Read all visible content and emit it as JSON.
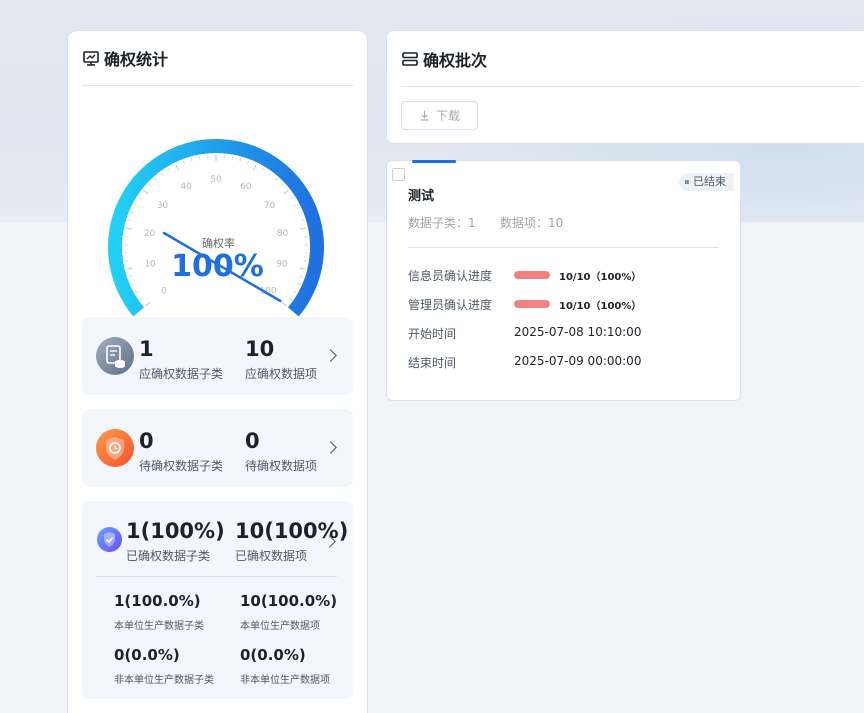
{
  "stats_panel": {
    "title": "确权统计",
    "gauge": {
      "label": "确权率",
      "value_text": "100%",
      "value": 100,
      "ticks": [
        "0",
        "10",
        "20",
        "30",
        "40",
        "50",
        "60",
        "70",
        "80",
        "90",
        "100"
      ]
    },
    "should_confirm": {
      "subclass_count": "1",
      "subclass_label": "应确权数据子类",
      "item_count": "10",
      "item_label": "应确权数据项"
    },
    "pending": {
      "subclass_count": "0",
      "subclass_label": "待确权数据子类",
      "item_count": "0",
      "item_label": "待确权数据项"
    },
    "confirmed": {
      "subclass_count": "1(100%)",
      "subclass_label": "已确权数据子类",
      "item_count": "10(100%)",
      "item_label": "已确权数据项",
      "own_subclass": "1(100.0%)",
      "own_subclass_label": "本单位生产数据子类",
      "own_item": "10(100.0%)",
      "own_item_label": "本单位生产数据项",
      "other_subclass": "0(0.0%)",
      "other_subclass_label": "非本单位生产数据子类",
      "other_item": "0(0.0%)",
      "other_item_label": "非本单位生产数据项"
    }
  },
  "batch_panel": {
    "title": "确权批次",
    "download_label": "下载"
  },
  "batch_item": {
    "title": "测试",
    "status": "已结束",
    "subclass_meta": "数据子类：1",
    "item_meta": "数据项：10",
    "info_progress_label": "信息员确认进度",
    "info_progress_text": "10/10（100%）",
    "info_progress_value": 1.0,
    "admin_progress_label": "管理员确认进度",
    "admin_progress_text": "10/10（100%）",
    "admin_progress_value": 1.0,
    "start_label": "开始时间",
    "start_value": "2025-07-08 10:10:00",
    "end_label": "结束时间",
    "end_value": "2025-07-09 00:00:00"
  },
  "colors": {
    "accent": "#1f6fe0",
    "progress": "#f28080",
    "gauge_start": "#22d0f5",
    "gauge_end": "#1f6fe0"
  }
}
